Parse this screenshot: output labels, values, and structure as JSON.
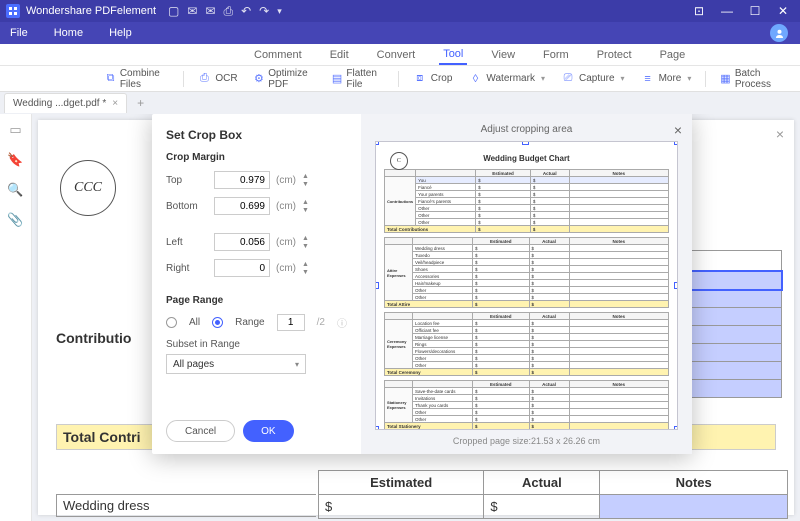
{
  "app": {
    "name": "Wondershare PDFelement"
  },
  "menubar": {
    "file": "File",
    "home": "Home",
    "help": "Help"
  },
  "ribbon": {
    "comment": "Comment",
    "edit": "Edit",
    "convert": "Convert",
    "tool": "Tool",
    "view": "View",
    "form": "Form",
    "protect": "Protect",
    "page": "Page"
  },
  "tools": {
    "combine": "Combine Files",
    "ocr": "OCR",
    "optimize": "Optimize PDF",
    "flatten": "Flatten File",
    "crop": "Crop",
    "watermark": "Watermark",
    "capture": "Capture",
    "more": "More",
    "batch": "Batch Process"
  },
  "doctab": {
    "name": "Wedding ...dget.pdf *"
  },
  "dialog": {
    "title": "Set Crop Box",
    "margin_title": "Crop Margin",
    "top_label": "Top",
    "top": "0.979",
    "bottom_label": "Bottom",
    "bottom": "0.699",
    "left_label": "Left",
    "left": "0.056",
    "right_label": "Right",
    "right": "0",
    "unit": "(cm)",
    "page_range_title": "Page Range",
    "all": "All",
    "range": "Range",
    "range_val": "1",
    "range_total": "/2",
    "subset_label": "Subset in Range",
    "subset_value": "All pages",
    "cancel": "Cancel",
    "ok": "OK",
    "preview_title": "Adjust cropping area",
    "preview_footer": "Cropped page size:21.53 x 26.26 cm"
  },
  "preview_doc": {
    "title": "Wedding Budget Chart",
    "headers": {
      "est": "Estimated",
      "act": "Actual",
      "notes": "Notes"
    },
    "sections": [
      {
        "name": "Contributions",
        "rows": [
          "You",
          "Fiancé",
          "Your parents",
          "Fiancé's parents",
          "Other",
          "Other",
          "Other"
        ],
        "total": "Total Contributions"
      },
      {
        "name": "Attire Expenses",
        "rows": [
          "Wedding dress",
          "Tuxedo",
          "Veil/headpiece",
          "Shoes",
          "Accessories",
          "Hair/makeup",
          "Other",
          "Other"
        ],
        "total": "Total Attire"
      },
      {
        "name": "Ceremony Expenses",
        "rows": [
          "Location fee",
          "Officiant fee",
          "Marriage license",
          "Rings",
          "Flowers/decorations",
          "Other",
          "Other"
        ],
        "total": "Total Ceremony"
      },
      {
        "name": "Stationery Expenses",
        "rows": [
          "Save-the-date cards",
          "Invitations",
          "Thank you cards",
          "Other",
          "Other"
        ],
        "total": "Total Stationery"
      }
    ]
  },
  "bg": {
    "contrib": "Contributio",
    "total": "Total Contri",
    "th_est": "Estimated",
    "th_act": "Actual",
    "th_notes": "Notes",
    "row1": "Wedding dress",
    "dollar": "$"
  }
}
